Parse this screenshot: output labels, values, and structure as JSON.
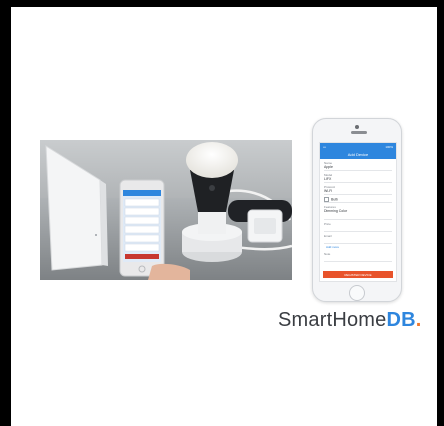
{
  "logo": {
    "light_text": "SmartHome",
    "bold_text": "DB",
    "dot_text": ".",
    "colors": {
      "dark": "#3a3d42",
      "blue": "#2e86de",
      "orange": "#f0782c"
    }
  },
  "photo": {
    "description_icon": "smart-bulb-setup-photo"
  },
  "phone_app": {
    "status_left": "•••",
    "status_right": "100%",
    "title": "Add Device",
    "fields": [
      {
        "label": "Name",
        "value": "Apple"
      },
      {
        "label": "Model",
        "value": "LIFX"
      },
      {
        "label": "Protocol",
        "value": "Wi-Fi"
      },
      {
        "label": "",
        "value": "Bulb"
      },
      {
        "label": "Features",
        "value": "Dimming Color"
      },
      {
        "label": "Price",
        "value": ""
      },
      {
        "label": "Email",
        "value": ""
      }
    ],
    "add_link": "Add more",
    "note_label": "Note",
    "note_value": "",
    "submit_label": "REGISTER DEVICE",
    "accent": "#2e86de",
    "submit_color": "#e8532b"
  }
}
